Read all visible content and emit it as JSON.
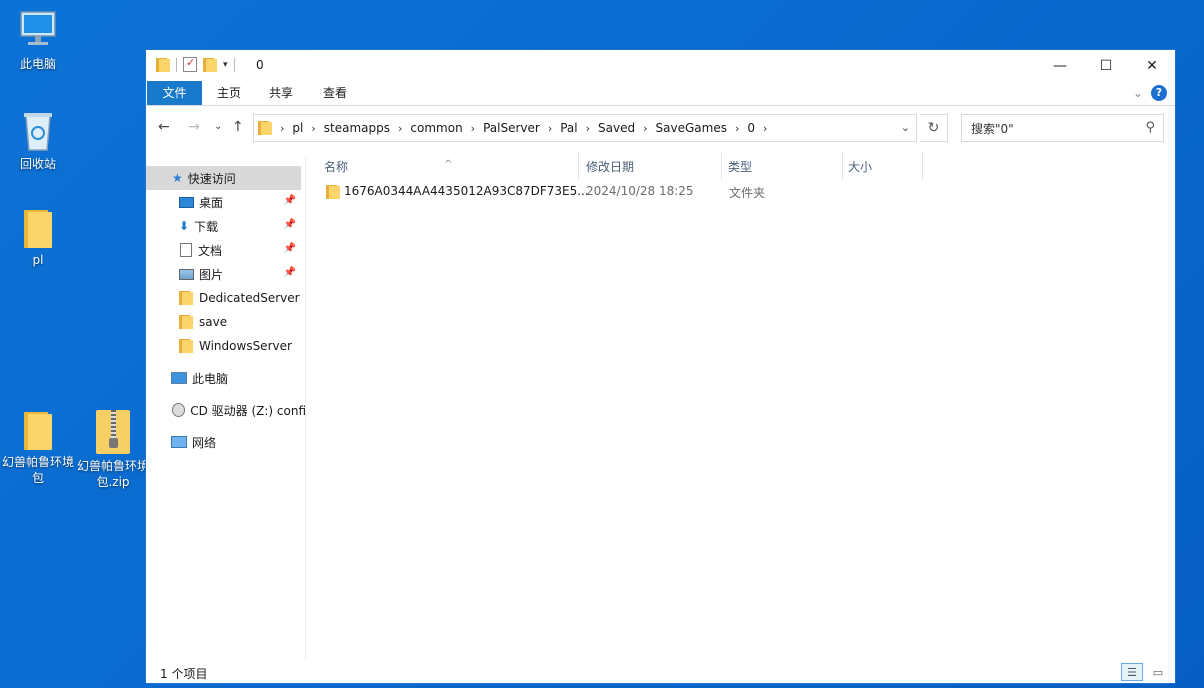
{
  "desktop": {
    "icons": [
      {
        "label": "此电脑"
      },
      {
        "label": "回收站"
      },
      {
        "label": "pl"
      },
      {
        "label": "幻兽帕鲁环境包"
      },
      {
        "label": "幻兽帕鲁环境包.zip"
      }
    ]
  },
  "window": {
    "title": "0",
    "controls": {
      "minimize": "—",
      "maximize": "☐",
      "close": "✕"
    }
  },
  "ribbon": {
    "tabs": [
      "文件",
      "主页",
      "共享",
      "查看"
    ]
  },
  "address": {
    "breadcrumbs": [
      "pl",
      "steamapps",
      "common",
      "PalServer",
      "Pal",
      "Saved",
      "SaveGames",
      "0"
    ]
  },
  "search": {
    "placeholder": "搜索\"0\""
  },
  "nav_pane": {
    "quick_access": "快速访问",
    "pinned": [
      {
        "label": "桌面"
      },
      {
        "label": "下载"
      },
      {
        "label": "文档"
      },
      {
        "label": "图片"
      }
    ],
    "folders": [
      "DedicatedServer",
      "save",
      "WindowsServer"
    ],
    "this_pc": "此电脑",
    "cd_drive": "CD 驱动器 (Z:) confi",
    "network": "网络"
  },
  "columns": {
    "name": "名称",
    "date": "修改日期",
    "type": "类型",
    "size": "大小"
  },
  "files": [
    {
      "name": "1676A0344AA4435012A93C87DF73E5...",
      "date": "2024/10/28 18:25",
      "type": "文件夹",
      "size": ""
    }
  ],
  "status": {
    "item_count": "1 个项目"
  },
  "colors": {
    "desktop_bg": "#0a6bd0",
    "file_tab": "#1979ca",
    "selected_nav": "#d9d9d9"
  }
}
